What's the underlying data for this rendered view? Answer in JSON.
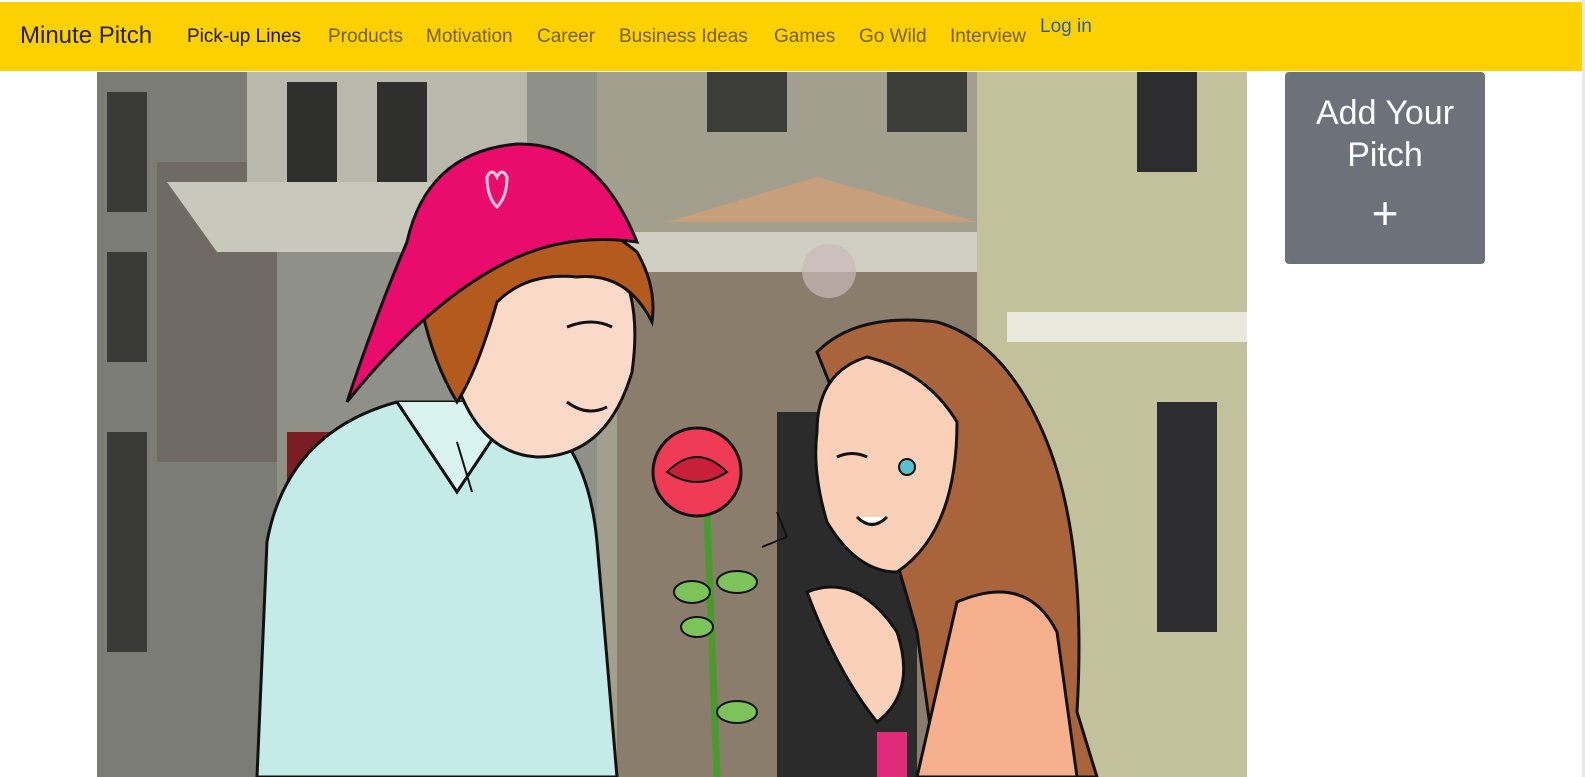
{
  "navbar": {
    "brand": "Minute Pitch",
    "links": [
      {
        "label": "Pick-up Lines",
        "active": true
      },
      {
        "label": "Products"
      },
      {
        "label": "Motivation"
      },
      {
        "label": "Career"
      },
      {
        "label": "Business Ideas"
      },
      {
        "label": "Games"
      },
      {
        "label": "Go Wild"
      },
      {
        "label": "Interview"
      }
    ],
    "login": "Log in"
  },
  "sidebar": {
    "add_pitch_title": "Add Your Pitch",
    "add_pitch_icon": "+"
  },
  "hero": {
    "image": "illustration-boy-giving-rose-to-girl"
  },
  "colors": {
    "navbar_bg": "#fdd100",
    "card_bg": "#6c717a",
    "login_link": "#2a5db0"
  }
}
